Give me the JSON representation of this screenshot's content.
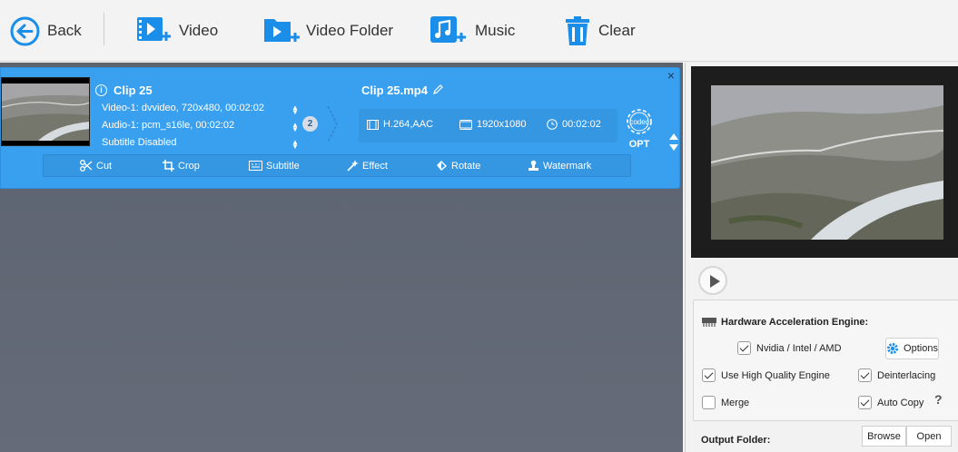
{
  "toolbar": {
    "back": "Back",
    "video": "Video",
    "video_folder": "Video Folder",
    "music": "Music",
    "clear": "Clear"
  },
  "clip": {
    "title": "Clip 25",
    "video_track": "Video-1: dvvideo, 720x480, 00:02:02",
    "audio_track": "Audio-1: pcm_s16le, 00:02:02",
    "subtitle": "Subtitle Disabled",
    "audio_count": "2",
    "output_name": "Clip 25.mp4",
    "format": "H.264,AAC",
    "resolution": "1920x1080",
    "duration": "00:02:02",
    "codec_label": "codec",
    "opt_label": "OPT",
    "close": "×"
  },
  "edit_bar": {
    "cut": "Cut",
    "crop": "Crop",
    "subtitle": "Subtitle",
    "effect": "Effect",
    "rotate": "Rotate",
    "watermark": "Watermark"
  },
  "settings": {
    "hw_title": "Hardware Acceleration Engine:",
    "nvidia": "Nvidia / Intel / AMD",
    "options": "Options",
    "high_quality": "Use High Quality Engine",
    "deinterlacing": "Deinterlacing",
    "merge": "Merge",
    "auto_copy": "Auto Copy",
    "help": "?",
    "output_folder": "Output Folder:",
    "browse": "Browse",
    "open": "Open"
  },
  "colors": {
    "accent": "#1a8ee8",
    "card": "#39a0f0",
    "workspace": "#5f6673"
  }
}
